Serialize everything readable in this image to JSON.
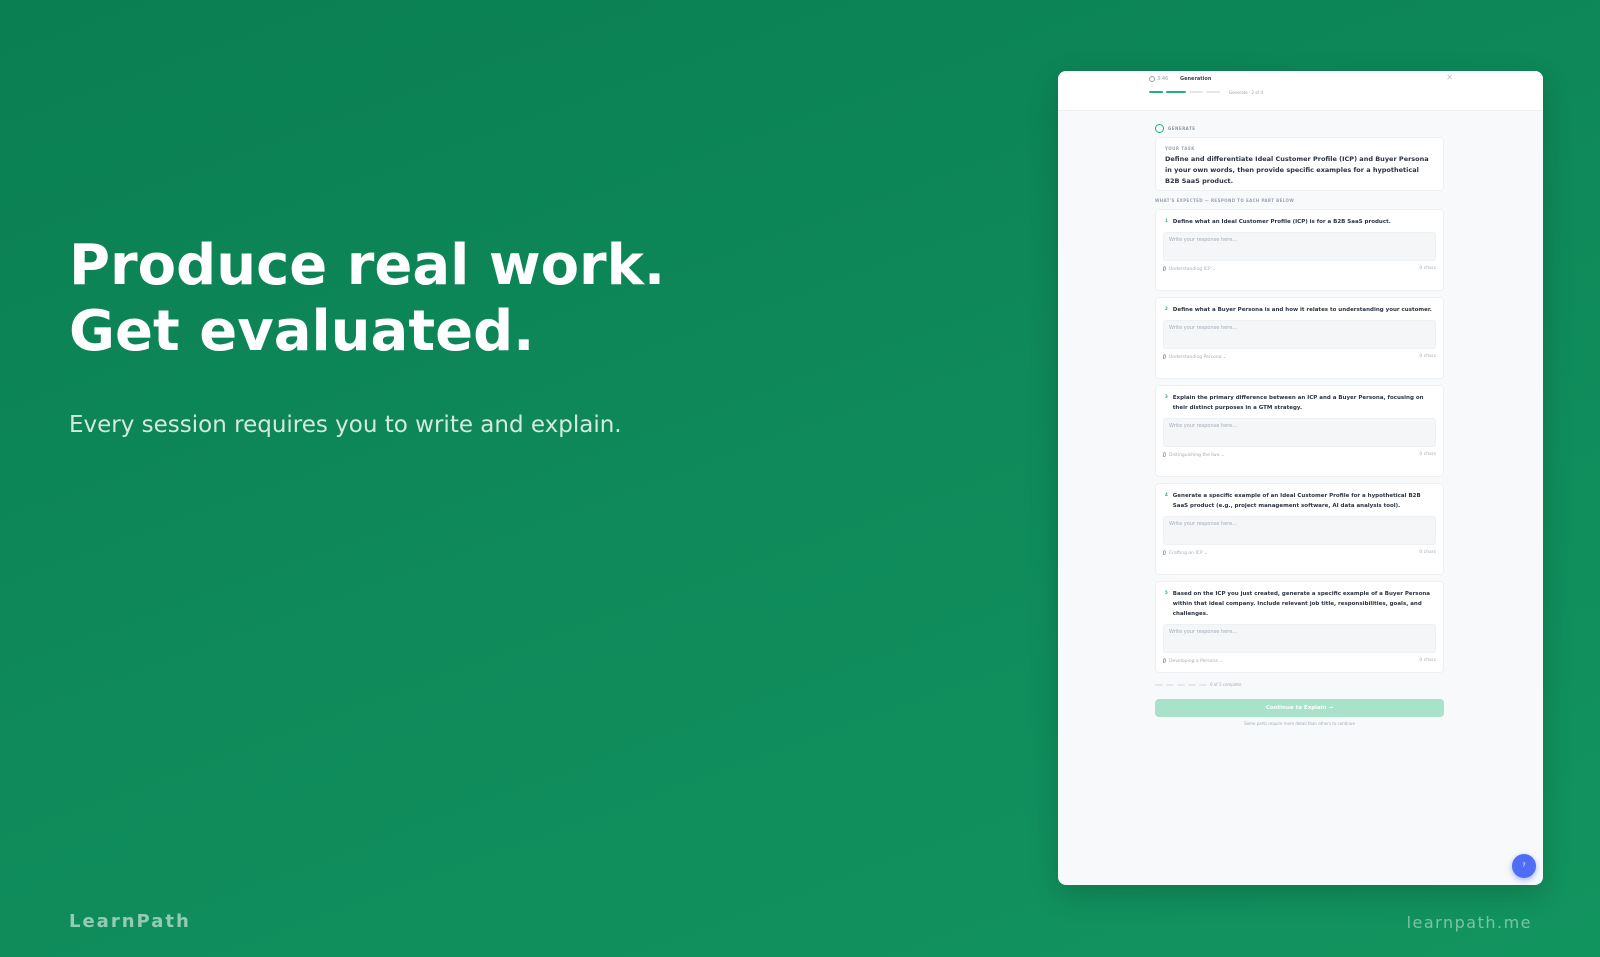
{
  "hero": {
    "line1": "Produce real work.",
    "line2": "Get evaluated.",
    "subtitle": "Every session requires you to write and explain."
  },
  "footer": {
    "brand": "LearnPath",
    "url": "learnpath.me"
  },
  "screen": {
    "timer": "3:46",
    "title": "Generation",
    "progress_label": "Generate · 2 of 4",
    "section_label": "GENERATE",
    "task_label": "YOUR TASK",
    "task_text": "Define and differentiate Ideal Customer Profile (ICP) and Buyer Persona in your own words, then provide specific examples for a hypothetical B2B SaaS product.",
    "expected_label": "WHAT'S EXPECTED — RESPOND TO EACH PART BELOW",
    "placeholder": "Write your response here...",
    "parts": [
      {
        "num": "1",
        "text": "Define what an Ideal Customer Profile (ICP) is for a B2B SaaS product.",
        "tag": "Understanding ICP",
        "chars": "0 chars"
      },
      {
        "num": "2",
        "text": "Define what a Buyer Persona is and how it relates to understanding your customer.",
        "tag": "Understanding Persona",
        "chars": "0 chars"
      },
      {
        "num": "3",
        "text": "Explain the primary difference between an ICP and a Buyer Persona, focusing on their distinct purposes in a GTM strategy.",
        "tag": "Distinguishing the two",
        "chars": "0 chars"
      },
      {
        "num": "4",
        "text": "Generate a specific example of an Ideal Customer Profile for a hypothetical B2B SaaS product (e.g., project management software, AI data analysis tool).",
        "tag": "Crafting an ICP",
        "chars": "0 chars"
      },
      {
        "num": "5",
        "text": "Based on the ICP you just created, generate a specific example of a Buyer Persona within that ideal company. Include relevant job title, responsibilities, goals, and challenges.",
        "tag": "Developing a Persona",
        "chars": "0 chars"
      }
    ],
    "status": "0 of 5 complete",
    "continue_label": "Continue to Explain →",
    "hint": "Some parts require more detail than others to continue",
    "fab_label": "?"
  },
  "colors": {
    "background": "#0f8a5a",
    "accent": "#23b07a",
    "fab": "#4f6df5"
  }
}
